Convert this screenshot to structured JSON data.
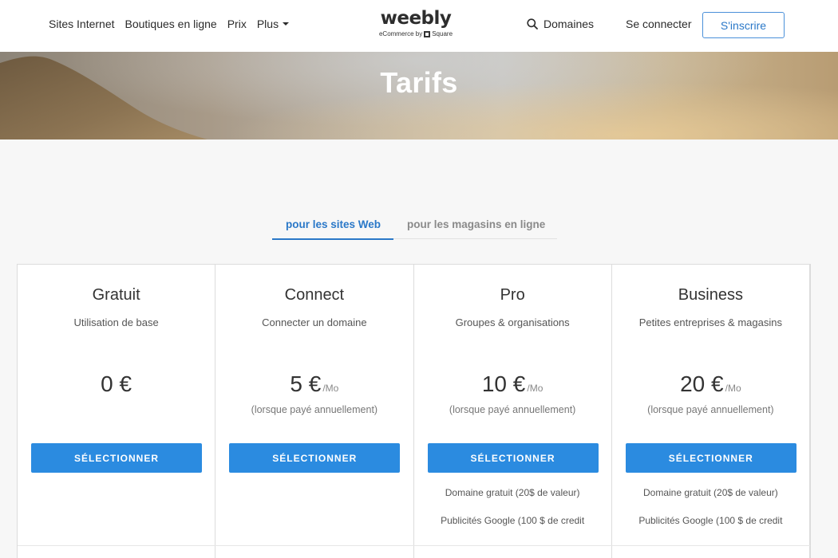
{
  "header": {
    "nav": [
      {
        "label": "Sites Internet"
      },
      {
        "label": "Boutiques en ligne"
      },
      {
        "label": "Prix"
      },
      {
        "label": "Plus"
      }
    ],
    "logo": {
      "word": "weebly",
      "sub_prefix": "eCommerce by",
      "sub_brand": "Square"
    },
    "domains_label": "Domaines",
    "login_label": "Se connecter",
    "signup_label": "S'inscrire"
  },
  "hero": {
    "title": "Tarifs"
  },
  "tabs": [
    {
      "label": "pour les sites Web",
      "active": true
    },
    {
      "label": "pour les magasins en ligne",
      "active": false
    }
  ],
  "plans": [
    {
      "name": "Gratuit",
      "desc": "Utilisation de base",
      "price": "0 €",
      "per": "",
      "note": "",
      "button": "SÉLECTIONNER",
      "features": []
    },
    {
      "name": "Connect",
      "desc": "Connecter un domaine",
      "price": "5 €",
      "per": "/Mo",
      "note": "(lorsque payé annuellement)",
      "button": "SÉLECTIONNER",
      "features": []
    },
    {
      "name": "Pro",
      "desc": "Groupes & organisations",
      "price": "10 €",
      "per": "/Mo",
      "note": "(lorsque payé annuellement)",
      "button": "SÉLECTIONNER",
      "features": [
        "Domaine gratuit (20$ de valeur)",
        "Publicités Google (100 $ de credit"
      ]
    },
    {
      "name": "Business",
      "desc": "Petites entreprises & magasins",
      "price": "20 €",
      "per": "/Mo",
      "note": "(lorsque payé annuellement)",
      "button": "SÉLECTIONNER",
      "features": [
        "Domaine gratuit (20$ de valeur)",
        "Publicités Google (100 $ de credit"
      ]
    }
  ],
  "colors": {
    "accent": "#2b8be0",
    "link_active": "#2a78c8",
    "text": "#333333",
    "page_bg": "#f7f7f7"
  },
  "icons": {
    "search": "search-icon",
    "caret": "chevron-down-icon",
    "square_logo": "square-logo-icon"
  }
}
